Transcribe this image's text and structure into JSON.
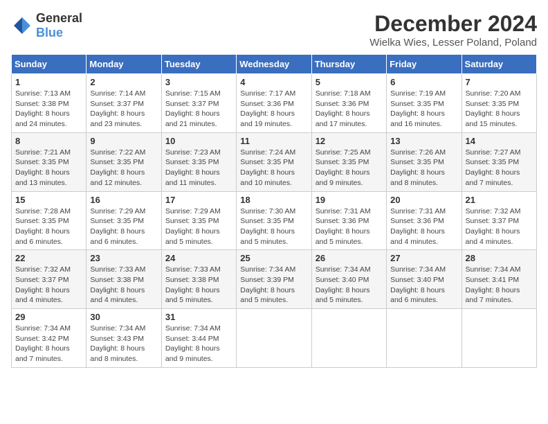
{
  "logo": {
    "general": "General",
    "blue": "Blue"
  },
  "title": "December 2024",
  "subtitle": "Wielka Wies, Lesser Poland, Poland",
  "days_of_week": [
    "Sunday",
    "Monday",
    "Tuesday",
    "Wednesday",
    "Thursday",
    "Friday",
    "Saturday"
  ],
  "weeks": [
    [
      {
        "day": "1",
        "sunrise": "7:13 AM",
        "sunset": "3:38 PM",
        "daylight": "8 hours and 24 minutes."
      },
      {
        "day": "2",
        "sunrise": "7:14 AM",
        "sunset": "3:37 PM",
        "daylight": "8 hours and 23 minutes."
      },
      {
        "day": "3",
        "sunrise": "7:15 AM",
        "sunset": "3:37 PM",
        "daylight": "8 hours and 21 minutes."
      },
      {
        "day": "4",
        "sunrise": "7:17 AM",
        "sunset": "3:36 PM",
        "daylight": "8 hours and 19 minutes."
      },
      {
        "day": "5",
        "sunrise": "7:18 AM",
        "sunset": "3:36 PM",
        "daylight": "8 hours and 17 minutes."
      },
      {
        "day": "6",
        "sunrise": "7:19 AM",
        "sunset": "3:35 PM",
        "daylight": "8 hours and 16 minutes."
      },
      {
        "day": "7",
        "sunrise": "7:20 AM",
        "sunset": "3:35 PM",
        "daylight": "8 hours and 15 minutes."
      }
    ],
    [
      {
        "day": "8",
        "sunrise": "7:21 AM",
        "sunset": "3:35 PM",
        "daylight": "8 hours and 13 minutes."
      },
      {
        "day": "9",
        "sunrise": "7:22 AM",
        "sunset": "3:35 PM",
        "daylight": "8 hours and 12 minutes."
      },
      {
        "day": "10",
        "sunrise": "7:23 AM",
        "sunset": "3:35 PM",
        "daylight": "8 hours and 11 minutes."
      },
      {
        "day": "11",
        "sunrise": "7:24 AM",
        "sunset": "3:35 PM",
        "daylight": "8 hours and 10 minutes."
      },
      {
        "day": "12",
        "sunrise": "7:25 AM",
        "sunset": "3:35 PM",
        "daylight": "8 hours and 9 minutes."
      },
      {
        "day": "13",
        "sunrise": "7:26 AM",
        "sunset": "3:35 PM",
        "daylight": "8 hours and 8 minutes."
      },
      {
        "day": "14",
        "sunrise": "7:27 AM",
        "sunset": "3:35 PM",
        "daylight": "8 hours and 7 minutes."
      }
    ],
    [
      {
        "day": "15",
        "sunrise": "7:28 AM",
        "sunset": "3:35 PM",
        "daylight": "8 hours and 6 minutes."
      },
      {
        "day": "16",
        "sunrise": "7:29 AM",
        "sunset": "3:35 PM",
        "daylight": "8 hours and 6 minutes."
      },
      {
        "day": "17",
        "sunrise": "7:29 AM",
        "sunset": "3:35 PM",
        "daylight": "8 hours and 5 minutes."
      },
      {
        "day": "18",
        "sunrise": "7:30 AM",
        "sunset": "3:35 PM",
        "daylight": "8 hours and 5 minutes."
      },
      {
        "day": "19",
        "sunrise": "7:31 AM",
        "sunset": "3:36 PM",
        "daylight": "8 hours and 5 minutes."
      },
      {
        "day": "20",
        "sunrise": "7:31 AM",
        "sunset": "3:36 PM",
        "daylight": "8 hours and 4 minutes."
      },
      {
        "day": "21",
        "sunrise": "7:32 AM",
        "sunset": "3:37 PM",
        "daylight": "8 hours and 4 minutes."
      }
    ],
    [
      {
        "day": "22",
        "sunrise": "7:32 AM",
        "sunset": "3:37 PM",
        "daylight": "8 hours and 4 minutes."
      },
      {
        "day": "23",
        "sunrise": "7:33 AM",
        "sunset": "3:38 PM",
        "daylight": "8 hours and 4 minutes."
      },
      {
        "day": "24",
        "sunrise": "7:33 AM",
        "sunset": "3:38 PM",
        "daylight": "8 hours and 5 minutes."
      },
      {
        "day": "25",
        "sunrise": "7:34 AM",
        "sunset": "3:39 PM",
        "daylight": "8 hours and 5 minutes."
      },
      {
        "day": "26",
        "sunrise": "7:34 AM",
        "sunset": "3:40 PM",
        "daylight": "8 hours and 5 minutes."
      },
      {
        "day": "27",
        "sunrise": "7:34 AM",
        "sunset": "3:40 PM",
        "daylight": "8 hours and 6 minutes."
      },
      {
        "day": "28",
        "sunrise": "7:34 AM",
        "sunset": "3:41 PM",
        "daylight": "8 hours and 7 minutes."
      }
    ],
    [
      {
        "day": "29",
        "sunrise": "7:34 AM",
        "sunset": "3:42 PM",
        "daylight": "8 hours and 7 minutes."
      },
      {
        "day": "30",
        "sunrise": "7:34 AM",
        "sunset": "3:43 PM",
        "daylight": "8 hours and 8 minutes."
      },
      {
        "day": "31",
        "sunrise": "7:34 AM",
        "sunset": "3:44 PM",
        "daylight": "8 hours and 9 minutes."
      },
      null,
      null,
      null,
      null
    ]
  ]
}
